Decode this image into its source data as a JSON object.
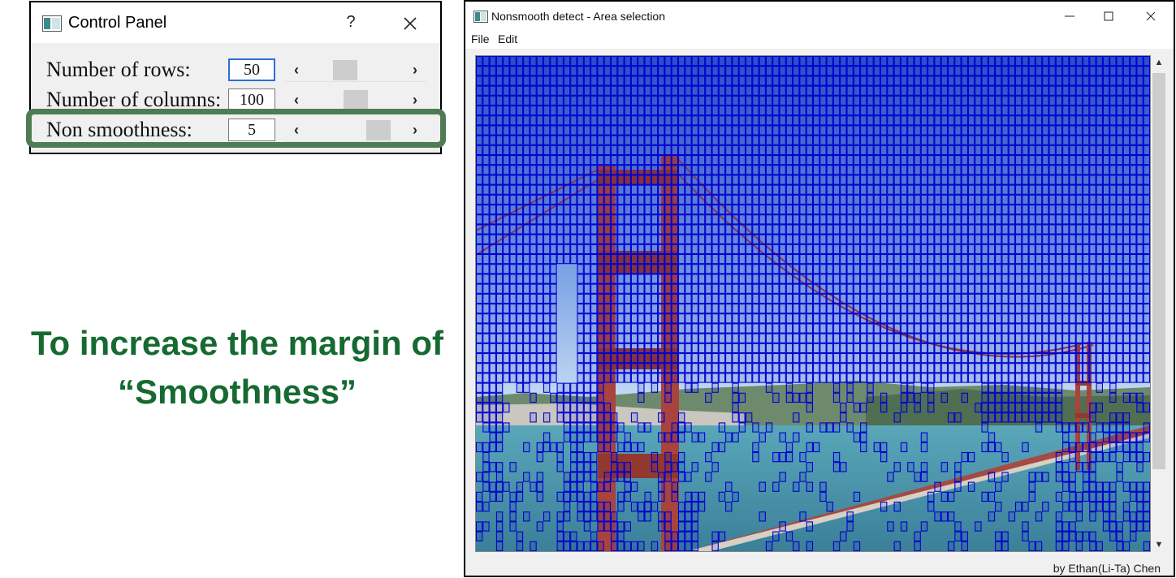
{
  "control_panel": {
    "title": "Control Panel",
    "help_label": "?",
    "icons": {
      "app": "app-icon",
      "close": "close-icon"
    },
    "rows": [
      {
        "label": "Number of rows:",
        "value": "50",
        "slider_fraction": 0.35
      },
      {
        "label": "Number of columns:",
        "value": "100",
        "slider_fraction": 0.5
      },
      {
        "label": "Non smoothness:",
        "value": "5",
        "slider_fraction": 0.82
      }
    ],
    "highlight_color": "#4e7c55"
  },
  "caption": {
    "line1": "To increase the margin of",
    "line2": "“Smoothness”",
    "color": "#166a31"
  },
  "main_window": {
    "title": "Nonsmooth detect - Area selection",
    "menu": [
      "File",
      "Edit"
    ],
    "icons": {
      "minimize": "minimize-icon",
      "maximize": "maximize-icon",
      "close": "close-icon"
    },
    "image_subject": "Golden Gate Bridge photo overlaid with blue selection grid",
    "grid_color": "#0000d0",
    "credit": "by Ethan(Li-Ta) Chen"
  }
}
